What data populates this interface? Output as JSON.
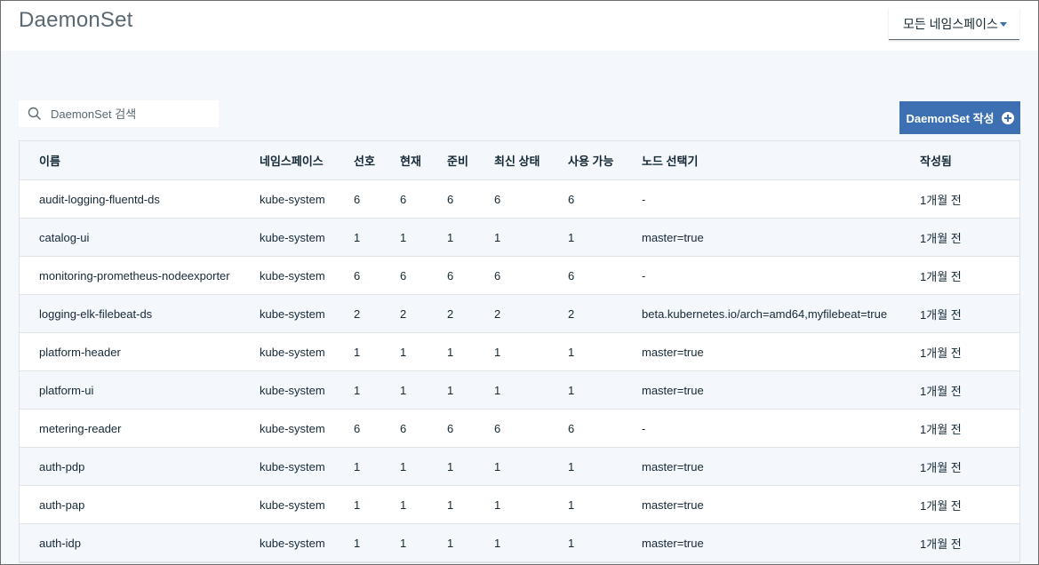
{
  "page": {
    "title": "DaemonSet",
    "namespace_dropdown": "모든 네임스페이스",
    "search_placeholder": "DaemonSet 검색",
    "create_button": "DaemonSet 작성"
  },
  "colors": {
    "accent": "#3d70b2",
    "background": "#f4f7fb",
    "text": "#152935",
    "border": "#dfe3e6"
  },
  "table": {
    "columns": [
      "이름",
      "네임스페이스",
      "선호",
      "현재",
      "준비",
      "최신 상태",
      "사용 가능",
      "노드 선택기",
      "작성됨"
    ],
    "rows": [
      [
        "audit-logging-fluentd-ds",
        "kube-system",
        "6",
        "6",
        "6",
        "6",
        "6",
        "-",
        "1개월 전"
      ],
      [
        "catalog-ui",
        "kube-system",
        "1",
        "1",
        "1",
        "1",
        "1",
        "master=true",
        "1개월 전"
      ],
      [
        "monitoring-prometheus-nodeexporter",
        "kube-system",
        "6",
        "6",
        "6",
        "6",
        "6",
        "-",
        "1개월 전"
      ],
      [
        "logging-elk-filebeat-ds",
        "kube-system",
        "2",
        "2",
        "2",
        "2",
        "2",
        "beta.kubernetes.io/arch=amd64,myfilebeat=true",
        "1개월 전"
      ],
      [
        "platform-header",
        "kube-system",
        "1",
        "1",
        "1",
        "1",
        "1",
        "master=true",
        "1개월 전"
      ],
      [
        "platform-ui",
        "kube-system",
        "1",
        "1",
        "1",
        "1",
        "1",
        "master=true",
        "1개월 전"
      ],
      [
        "metering-reader",
        "kube-system",
        "6",
        "6",
        "6",
        "6",
        "6",
        "-",
        "1개월 전"
      ],
      [
        "auth-pdp",
        "kube-system",
        "1",
        "1",
        "1",
        "1",
        "1",
        "master=true",
        "1개월 전"
      ],
      [
        "auth-pap",
        "kube-system",
        "1",
        "1",
        "1",
        "1",
        "1",
        "master=true",
        "1개월 전"
      ],
      [
        "auth-idp",
        "kube-system",
        "1",
        "1",
        "1",
        "1",
        "1",
        "master=true",
        "1개월 전"
      ]
    ]
  }
}
